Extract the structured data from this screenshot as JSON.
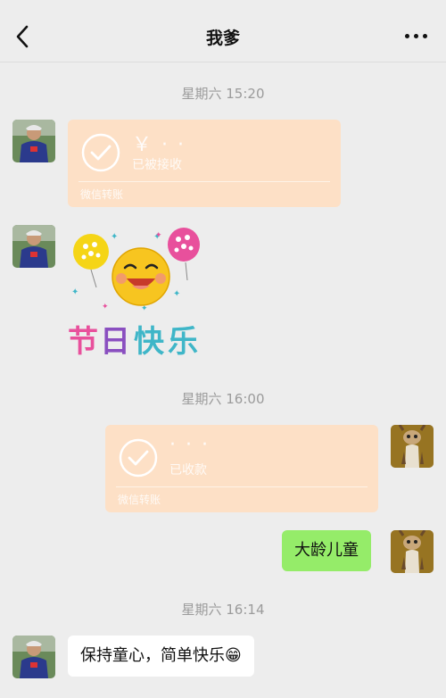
{
  "header": {
    "title": "我爹",
    "back_icon": "chevron-left-icon",
    "more_icon": "more-dots-icon"
  },
  "messages": {
    "timestamp_1": "星期六 15:20",
    "transfer_1": {
      "amount": "￥ · ·",
      "status": "已被接收",
      "label": "微信转账"
    },
    "sticker": {
      "text": "节日快乐",
      "icon": "festival-happy-sticker"
    },
    "timestamp_2": "星期六 16:00",
    "transfer_2": {
      "amount": "· · ·",
      "status": "已收款",
      "label": "微信转账"
    },
    "reply_1": "大龄儿童",
    "timestamp_3": "星期六 16:14",
    "reply_2": "保持童心，简单快乐😁"
  },
  "colors": {
    "background": "#ededed",
    "transfer_card": "#fde0c6",
    "sent_bubble": "#95ec69",
    "received_bubble": "#ffffff"
  }
}
